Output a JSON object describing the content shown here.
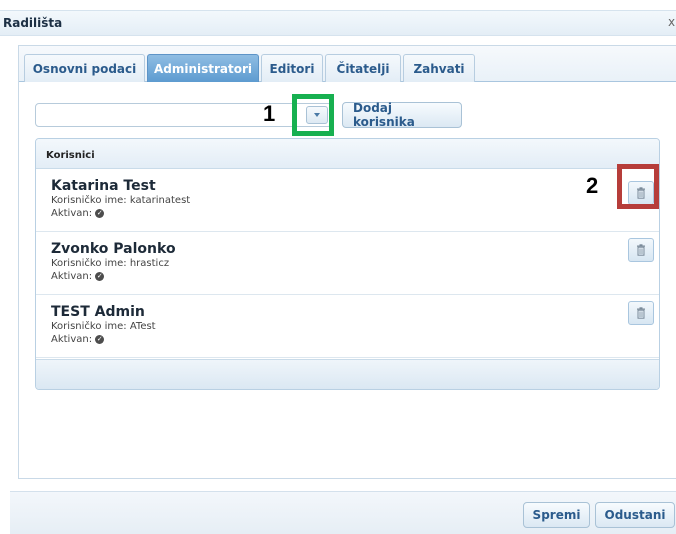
{
  "window": {
    "title": "Radilišta",
    "close_glyph": "x"
  },
  "tabs": [
    {
      "label": "Osnovni podaci",
      "active": false
    },
    {
      "label": "Administratori",
      "active": true
    },
    {
      "label": "Editori",
      "active": false
    },
    {
      "label": "Čitatelji",
      "active": false
    },
    {
      "label": "Zahvati",
      "active": false
    }
  ],
  "user_picker": {
    "value": "",
    "placeholder": ""
  },
  "add_user_label": "Dodaj korisnika",
  "annotations": {
    "marker_1": "1",
    "marker_2": "2"
  },
  "users_panel": {
    "header": "Korisnici",
    "users": [
      {
        "name": "Katarina Test",
        "username_line": "Korisničko ime: katarinatest",
        "active_label": "Aktivan:"
      },
      {
        "name": "Zvonko Palonko",
        "username_line": "Korisničko ime: hrasticz",
        "active_label": "Aktivan:"
      },
      {
        "name": "TEST Admin",
        "username_line": "Korisničko ime: ATest",
        "active_label": "Aktivan:"
      }
    ]
  },
  "footer": {
    "save_label": "Spremi",
    "cancel_label": "Odustani"
  },
  "colors": {
    "accent": "#5d9bd0",
    "highlight_dropdown": "#17b050",
    "highlight_delete": "#b63d3a"
  },
  "icons": {
    "dropdown": "chevron-down-icon",
    "delete": "trash-icon",
    "active_status": "check-circle-icon"
  }
}
